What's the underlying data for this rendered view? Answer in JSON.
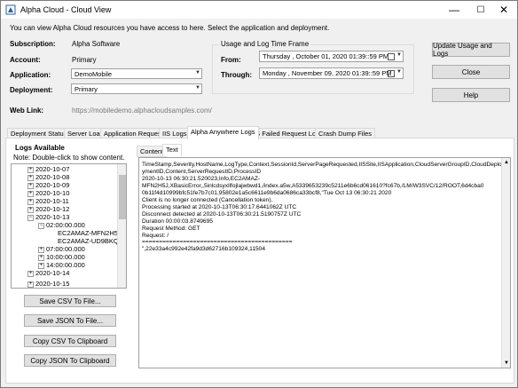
{
  "window": {
    "title": "Alpha Cloud - Cloud View",
    "minimize": "—",
    "maximize": "☐",
    "close": "✕"
  },
  "intro_text": "You can view Alpha Cloud resources you have access to here.  Select the application and deployment.",
  "fields": {
    "subscription_label": "Subscription:",
    "subscription_value": "Alpha Software",
    "account_label": "Account:",
    "account_value": "Primary",
    "application_label": "Application:",
    "application_value": "DemoMobile",
    "deployment_label": "Deployment:",
    "deployment_value": "Primary",
    "weblink_label": "Web Link:",
    "weblink_value": "https://mobiledemo.alphacloudsamples.com/"
  },
  "timeframe": {
    "group_label": "Usage and Log Time Frame",
    "from_label": "From:",
    "from_value": "Thursday  ,   October   01, 2020 01:39::59 PM",
    "through_label": "Through:",
    "through_value": "Monday   ,  November 09, 2020 01:39::59 PM"
  },
  "buttons": {
    "update": "Update Usage and Logs",
    "close": "Close",
    "help": "Help",
    "save_csv": "Save CSV To File...",
    "save_json": "Save JSON To File...",
    "copy_csv": "Copy CSV To Clipboard",
    "copy_json": "Copy JSON To Clipboard"
  },
  "tabs": [
    {
      "label": "Deployment Status"
    },
    {
      "label": "Server Load"
    },
    {
      "label": "Application Requests"
    },
    {
      "label": "IIS Logs"
    },
    {
      "label": "Alpha Anywhere Logs"
    },
    {
      "label": "IIS Failed Request Logs"
    },
    {
      "label": "Crash Dump Files"
    }
  ],
  "logs": {
    "heading": "Logs Available",
    "note": "Note: Double-click to show content.",
    "tree": [
      {
        "label": "2020-10-07",
        "sign": "+"
      },
      {
        "label": "2020-10-08",
        "sign": "+"
      },
      {
        "label": "2020-10-09",
        "sign": "+"
      },
      {
        "label": "2020-10-10",
        "sign": "+"
      },
      {
        "label": "2020-10-11",
        "sign": "+"
      },
      {
        "label": "2020-10-12",
        "sign": "+"
      },
      {
        "label": "2020-10-13",
        "sign": "−"
      },
      {
        "label": "02:00:00.000",
        "sign": "−"
      },
      {
        "label": "EC2AMAZ-MFN2H5J",
        "sign": ""
      },
      {
        "label": "EC2AMAZ-UD9BKQ1",
        "sign": ""
      },
      {
        "label": "07:00:00.000",
        "sign": "+"
      },
      {
        "label": "10:00:00.000",
        "sign": "+"
      },
      {
        "label": "14:00:00.000",
        "sign": "+"
      },
      {
        "label": "2020-10-14",
        "sign": "+"
      },
      {
        "label": "2020-10-15",
        "sign": "+"
      }
    ]
  },
  "subtabs": {
    "content": "Content",
    "text": "Text"
  },
  "log_text": [
    "TimeStamp,Severity,HostName,LogType,Context,SessionId,ServerPageRequested,IISSite,IISApplication,CloudServerGroupID,CloudDeplo",
    "ymentID,Content,ServerRequestID,ProcessID",
    "2020-10-13 06:30:21.520023,Info,EC2AMAZ-",
    "MFN2H5J,XBasicError,,5inlcdsyxllfojlajwbwd1,/index.a5w,A5339653239c5211e6b6cd061610?fc67b,/LM/W3SVC/12/ROOT,6d4cba0",
    "0b11f4d10999bfc51fe7b7c01,95802e1a5c6611e9b6da0686ca33bcf8,\"Tue Oct 13 06:30:21 2020",
    "Client is no longer connected (Cancellation token).",
    " Processing started at 2020-10-13T06:30:17.6441062Z UTC",
    "Disconnect detected at 2020-10-13T06:30:21.5190757Z UTC",
    "              Duration 00:00:03.8749695",
    "Request Method: GET",
    "Request: /",
    "============================================",
    "\",22e33a4c992e42fa9d3d62716b109324,11504"
  ]
}
